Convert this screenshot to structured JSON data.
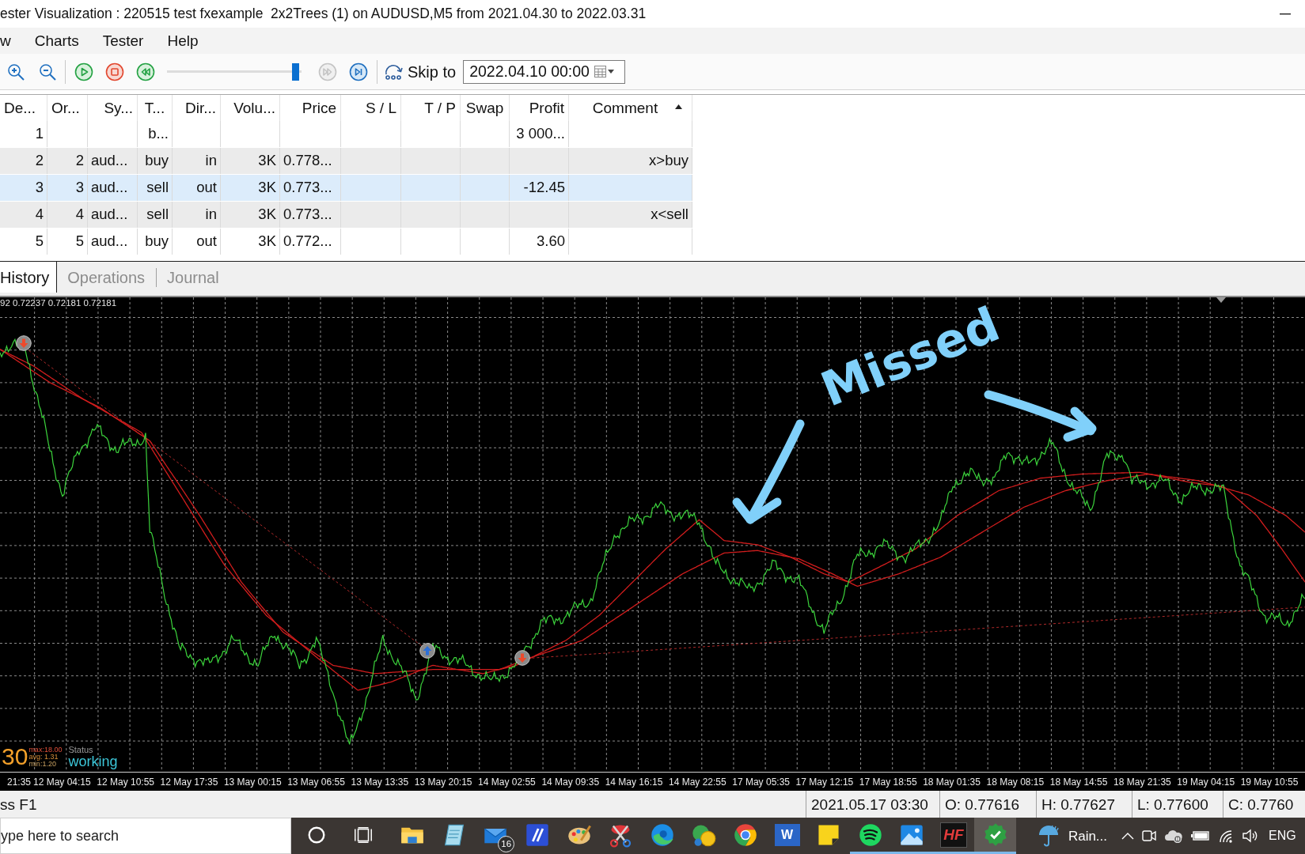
{
  "window": {
    "title": "ester Visualization : 220515 test fxexample  2x2Trees (1) on AUDUSD,M5 from 2021.04.30 to 2022.03.31"
  },
  "menu": [
    {
      "label": "w"
    },
    {
      "label": "Charts"
    },
    {
      "label": "Tester"
    },
    {
      "label": "Help"
    }
  ],
  "toolbar": {
    "view_buttons": [
      {
        "kind": "zoom-in",
        "disabled": false
      },
      {
        "kind": "zoom-out",
        "disabled": false
      }
    ],
    "playback_buttons": [
      {
        "kind": "play",
        "disabled": false
      },
      {
        "kind": "stop",
        "disabled": false
      },
      {
        "kind": "rewind",
        "disabled": false
      }
    ],
    "speed": {
      "level": 0.98
    },
    "step_buttons": [
      {
        "kind": "fast-forward",
        "disabled": true
      },
      {
        "kind": "skip-to-end",
        "disabled": false
      }
    ],
    "skip_to": {
      "label": "Skip to",
      "value": "2022.04.10 00:00"
    }
  },
  "table": {
    "columns": [
      {
        "label": "De...",
        "sorted": false
      },
      {
        "label": "Or...",
        "sorted": false
      },
      {
        "label": "Sy...",
        "sorted": false
      },
      {
        "label": "T...",
        "sorted": false
      },
      {
        "label": "Dir...",
        "sorted": false
      },
      {
        "label": "Volu...",
        "sorted": false
      },
      {
        "label": "Price",
        "sorted": false
      },
      {
        "label": "S / L",
        "sorted": false
      },
      {
        "label": "T / P",
        "sorted": false
      },
      {
        "label": "Swap",
        "sorted": false
      },
      {
        "label": "Profit",
        "sorted": false
      },
      {
        "label": "Comment",
        "sorted": true
      }
    ],
    "rows": [
      {
        "selected": false,
        "cells": {
          "column_1": "1",
          "column_4": "b...",
          "column_11": "3 000..."
        }
      },
      {
        "selected": false,
        "cells": {
          "column_1": "2",
          "column_2": "2",
          "column_3": "aud...",
          "column_4": "buy",
          "column_5": "in",
          "column_6": "3K",
          "column_7": "0.778...",
          "column_12": "x>buy"
        }
      },
      {
        "selected": true,
        "cells": {
          "column_1": "3",
          "column_2": "3",
          "column_3": "aud...",
          "column_4": "sell",
          "column_5": "out",
          "column_6": "3K",
          "column_7": "0.773...",
          "column_11": "-12.45"
        }
      },
      {
        "selected": false,
        "cells": {
          "column_1": "4",
          "column_2": "4",
          "column_3": "aud...",
          "column_4": "sell",
          "column_5": "in",
          "column_6": "3K",
          "column_7": "0.773...",
          "column_12": "x<sell"
        }
      },
      {
        "selected": false,
        "cells": {
          "column_1": "5",
          "column_2": "5",
          "column_3": "aud...",
          "column_4": "buy",
          "column_5": "out",
          "column_6": "3K",
          "column_7": "0.772...",
          "column_11": "3.60"
        }
      }
    ]
  },
  "tabs": [
    {
      "label": "History",
      "selected": true
    },
    {
      "label": "Operations",
      "selected": false
    },
    {
      "label": "Journal",
      "selected": false
    }
  ],
  "chart": {
    "ohlc": "92 0.72237 0.72181 0.72181",
    "markers": [
      {
        "kind": "sell"
      },
      {
        "kind": "buy"
      },
      {
        "kind": "sell"
      }
    ],
    "panel": {
      "count": "30",
      "max": "max:18.00",
      "avg": "avg: 1.31",
      "min": "min:1.20",
      "status_label": "Status",
      "status": "working"
    },
    "annotation": {
      "text": "Missed"
    },
    "time_labels": [
      "21:35",
      "12 May 04:15",
      "12 May 10:55",
      "12 May 17:35",
      "13 May 00:15",
      "13 May 06:55",
      "13 May 13:35",
      "13 May 20:15",
      "14 May 02:55",
      "14 May 09:35",
      "14 May 16:15",
      "14 May 22:55",
      "17 May 05:35",
      "17 May 12:15",
      "17 May 18:55",
      "18 May 01:35",
      "18 May 08:15",
      "18 May 14:55",
      "18 May 21:35",
      "19 May 04:15",
      "19 May 10:55"
    ]
  },
  "status_bar": {
    "help": "ss F1",
    "time": "2021.05.17 03:30",
    "open": "O: 0.77616",
    "high": "H: 0.77627",
    "low": "L: 0.77600",
    "close": "C: 0.7760"
  },
  "taskbar": {
    "search": {
      "placeholder": "ype here to search"
    },
    "apps": [
      {
        "kind": "ring",
        "running": false,
        "selected": false
      },
      {
        "kind": "task-view",
        "running": false,
        "selected": false
      },
      {
        "kind": "folder",
        "running": false,
        "selected": false
      },
      {
        "kind": "notepad",
        "running": false,
        "selected": false
      },
      {
        "kind": "mail",
        "running": false,
        "selected": false,
        "badge": "16"
      },
      {
        "kind": "blue-app",
        "running": false,
        "selected": false
      },
      {
        "kind": "palette",
        "running": false,
        "selected": false
      },
      {
        "kind": "scissors",
        "running": false,
        "selected": false
      },
      {
        "kind": "edge",
        "running": false,
        "selected": false
      },
      {
        "kind": "trader",
        "running": false,
        "selected": false
      },
      {
        "kind": "chrome",
        "running": false,
        "selected": false
      },
      {
        "kind": "letter",
        "label": "W",
        "running": false,
        "selected": false
      },
      {
        "kind": "sticky",
        "running": false,
        "selected": false
      },
      {
        "kind": "music",
        "running": true,
        "selected": false
      },
      {
        "kind": "photos",
        "running": true,
        "selected": false
      },
      {
        "kind": "letter-dark",
        "label": "HF",
        "running": true,
        "selected": false
      },
      {
        "kind": "shield",
        "running": true,
        "selected": true
      }
    ],
    "weather": "Rain...",
    "tray": [
      {
        "kind": "chevron"
      },
      {
        "kind": "camera"
      },
      {
        "kind": "cloud"
      },
      {
        "kind": "battery"
      },
      {
        "kind": "wifi"
      },
      {
        "kind": "volume"
      }
    ],
    "language": "ENG"
  }
}
